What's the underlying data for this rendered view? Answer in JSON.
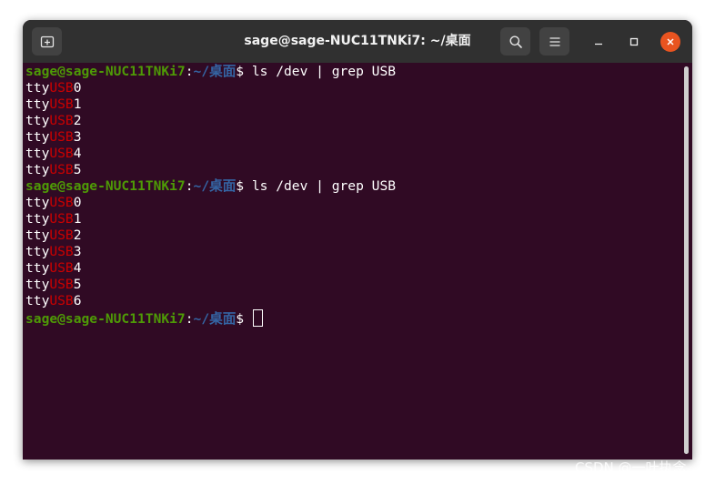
{
  "window": {
    "title": "sage@sage-NUC11TNKi7: ~/桌面",
    "icons": {
      "new_tab": "new-tab-icon",
      "search": "search-icon",
      "menu": "hamburger-menu-icon",
      "minimize": "minimize-icon",
      "maximize": "maximize-icon",
      "close": "close-icon"
    }
  },
  "colors": {
    "terminal_bg": "#300a24",
    "titlebar_bg": "#303030",
    "prompt_user": "#4e9a06",
    "prompt_path": "#3465a4",
    "grep_match": "#cc0000",
    "close_button": "#e95420"
  },
  "terminal": {
    "prompt": {
      "user": "sage@sage-NUC11TNKi7",
      "sep": ":",
      "path": "~/桌面",
      "symbol": "$ "
    },
    "command": "ls /dev | grep USB",
    "match": "USB",
    "lines": [
      {
        "type": "prompt",
        "cmd": "ls /dev | grep USB"
      },
      {
        "type": "out",
        "pre": "tty",
        "match": "USB",
        "post": "0"
      },
      {
        "type": "out",
        "pre": "tty",
        "match": "USB",
        "post": "1"
      },
      {
        "type": "out",
        "pre": "tty",
        "match": "USB",
        "post": "2"
      },
      {
        "type": "out",
        "pre": "tty",
        "match": "USB",
        "post": "3"
      },
      {
        "type": "out",
        "pre": "tty",
        "match": "USB",
        "post": "4"
      },
      {
        "type": "out",
        "pre": "tty",
        "match": "USB",
        "post": "5"
      },
      {
        "type": "prompt",
        "cmd": "ls /dev | grep USB"
      },
      {
        "type": "out",
        "pre": "tty",
        "match": "USB",
        "post": "0"
      },
      {
        "type": "out",
        "pre": "tty",
        "match": "USB",
        "post": "1"
      },
      {
        "type": "out",
        "pre": "tty",
        "match": "USB",
        "post": "2"
      },
      {
        "type": "out",
        "pre": "tty",
        "match": "USB",
        "post": "3"
      },
      {
        "type": "out",
        "pre": "tty",
        "match": "USB",
        "post": "4"
      },
      {
        "type": "out",
        "pre": "tty",
        "match": "USB",
        "post": "5"
      },
      {
        "type": "out",
        "pre": "tty",
        "match": "USB",
        "post": "6"
      },
      {
        "type": "prompt",
        "cmd": "",
        "cursor": true
      }
    ]
  },
  "watermark": "CSDN @一叶执念"
}
